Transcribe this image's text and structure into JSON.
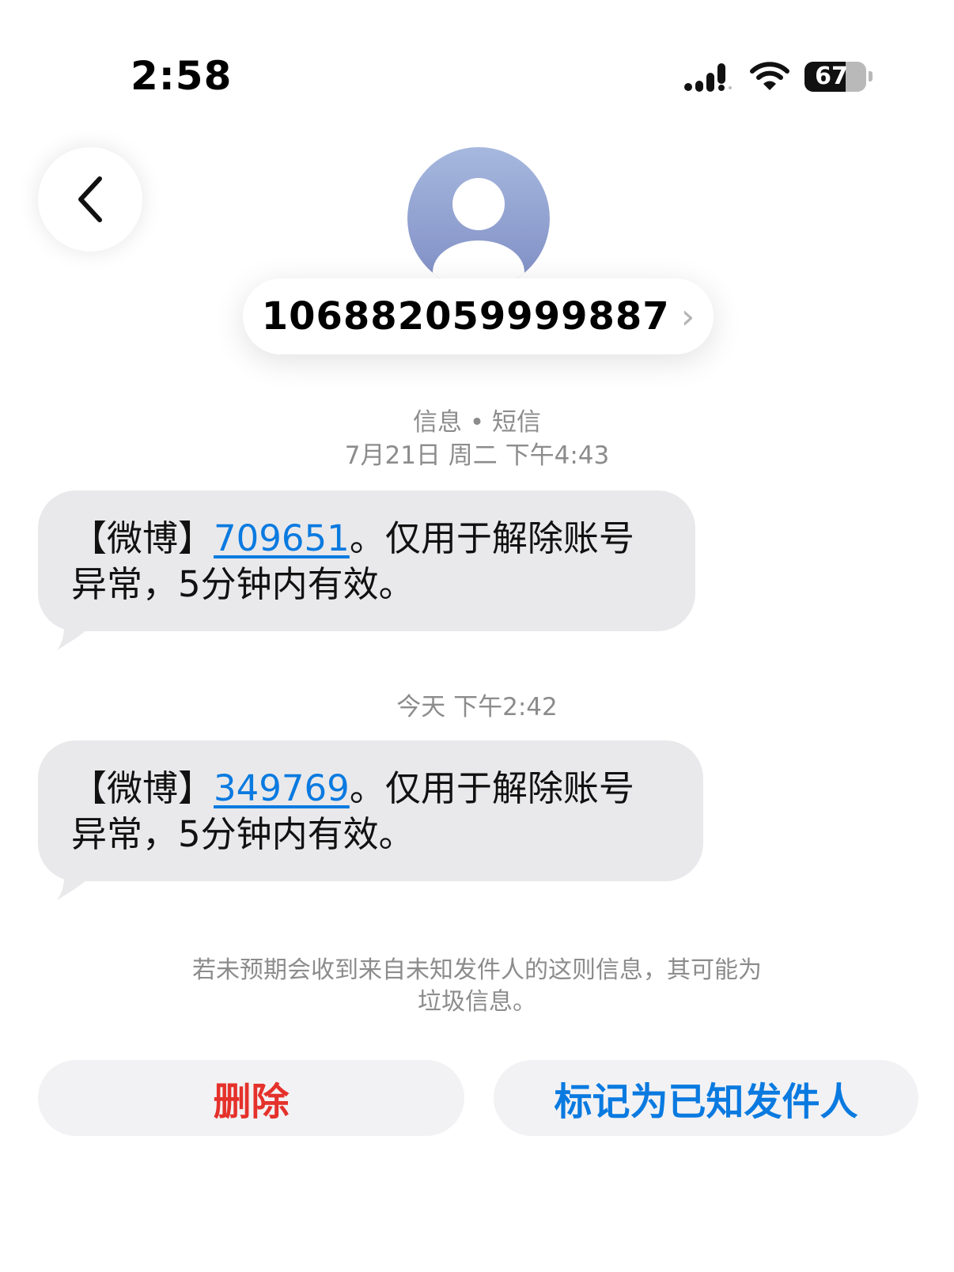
{
  "status_bar": {
    "time": "2:58",
    "battery_level": "67",
    "icons": [
      "cellular-signal-icon",
      "wifi-icon",
      "battery-icon"
    ]
  },
  "header": {
    "back_icon": "chevron-left-icon",
    "avatar_icon": "person-placeholder-icon",
    "contact_number": "106882059999887",
    "contact_chevron": "›"
  },
  "conversation": {
    "service_label": "信息 • 短信",
    "messages": [
      {
        "timestamp": "7月21日 周二 下午4:43",
        "prefix": "【微博】",
        "code": "709651",
        "line1_suffix": "。仅用于解除账号",
        "line2": "异常，5分钟内有效。"
      },
      {
        "timestamp": "今天 下午2:42",
        "prefix": "【微博】",
        "code": "349769",
        "line1_suffix": "。仅用于解除账号",
        "line2": "异常，5分钟内有效。"
      }
    ]
  },
  "notice": {
    "line1": "若未预期会收到来自未知发件人的这则信息，其可能为",
    "line2": "垃圾信息。"
  },
  "actions": {
    "delete_label": "删除",
    "mark_known_label": "标记为已知发件人"
  },
  "colors": {
    "bubble": "#e9e9eb",
    "link": "#0a7ae0",
    "destructive": "#e5312b",
    "meta_text": "#8c8c8c"
  }
}
